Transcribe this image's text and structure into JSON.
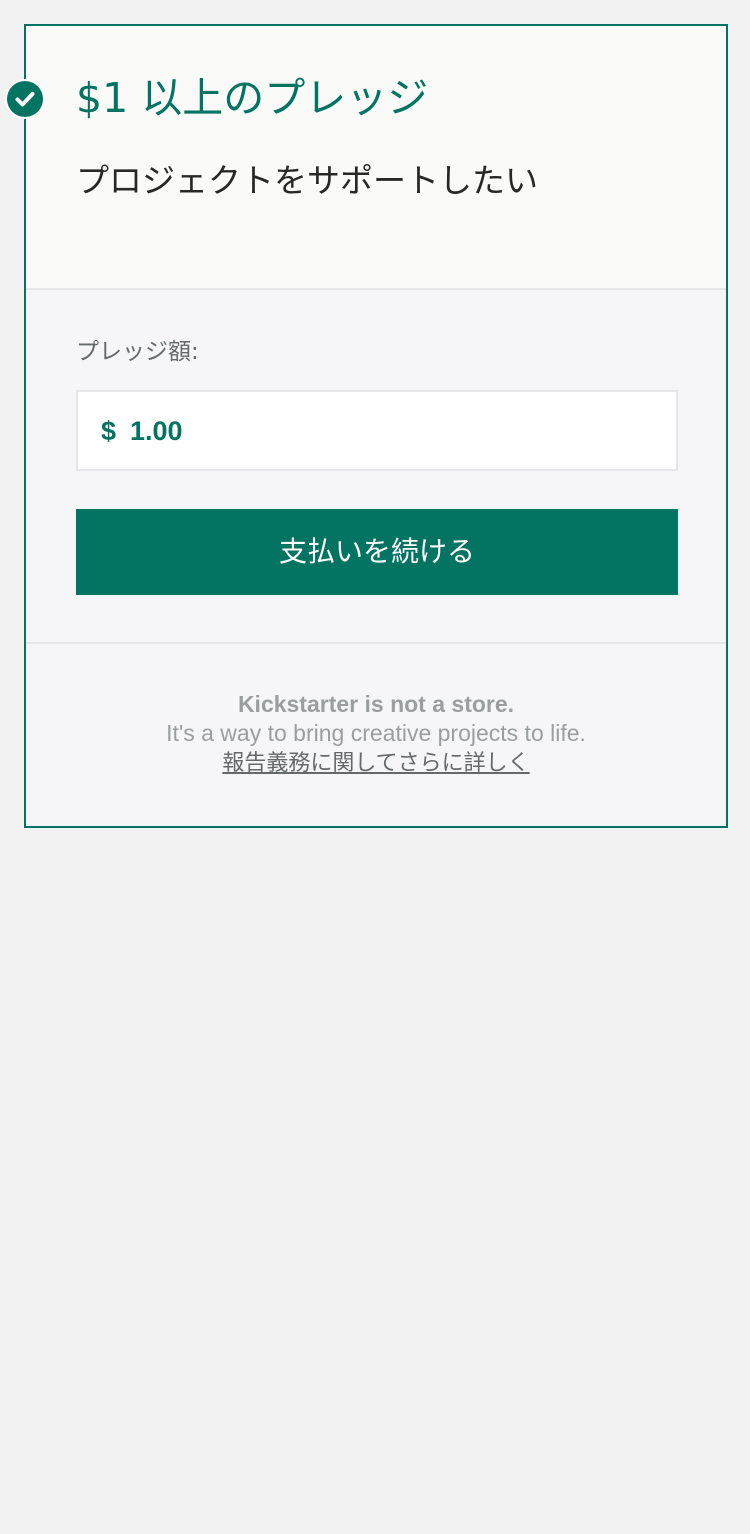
{
  "reward": {
    "title": "$1 以上のプレッジ",
    "description": "プロジェクトをサポートしたい",
    "selected_icon": "check-circle-icon"
  },
  "pledge": {
    "label": "プレッジ額:",
    "currency_symbol": "$",
    "amount": "1.00",
    "continue_label": "支払いを続ける"
  },
  "footer": {
    "store_notice": "Kickstarter is not a store.",
    "mission": "It's a way to bring creative projects to life.",
    "learn_more": "報告義務に関してさらに詳しく"
  },
  "colors": {
    "accent": "#037362",
    "page_background": "#f2f2f2",
    "card_background": "#f6f6f8",
    "text_dark": "#282828",
    "text_muted": "#9b9ea0"
  }
}
